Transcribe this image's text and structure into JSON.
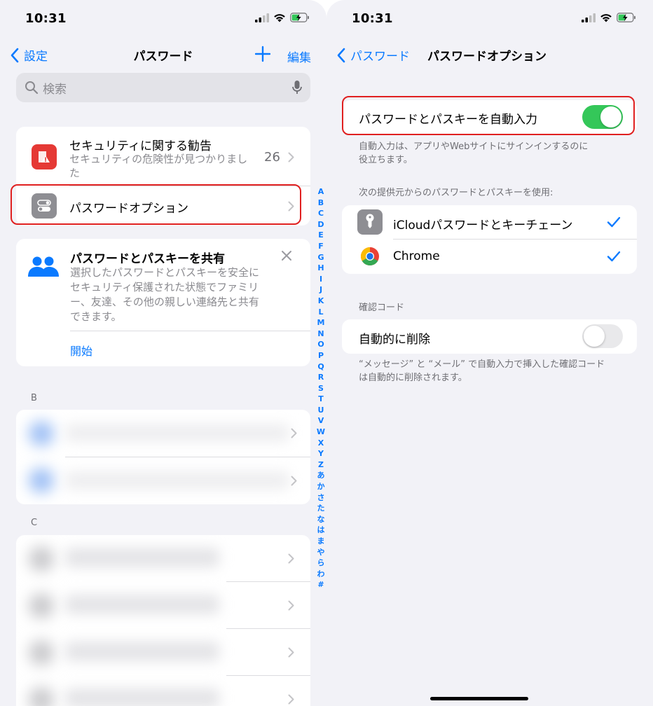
{
  "left": {
    "status_time": "10:31",
    "nav": {
      "back_label": "設定",
      "title": "パスワード",
      "edit_label": "編集"
    },
    "search": {
      "placeholder": "検索"
    },
    "security": {
      "title": "セキュリティに関する勧告",
      "subtitle_line1": "セキュリティの危険性が見つかりまし",
      "subtitle_line2": "た",
      "count": "26"
    },
    "options_row": {
      "label": "パスワードオプション"
    },
    "share_card": {
      "title": "パスワードとパスキーを共有",
      "body_line1": "選択したパスワードとパスキーを安全に",
      "body_line2": "セキュリティ保護された状態でファミリ",
      "body_line3": "ー、友達、その他の親しい連絡先と共有",
      "body_line4": "できます。",
      "start_label": "開始"
    },
    "section_b": "B",
    "section_c": "C",
    "index_letters": [
      "A",
      "B",
      "C",
      "D",
      "E",
      "F",
      "G",
      "H",
      "I",
      "J",
      "K",
      "L",
      "M",
      "N",
      "O",
      "P",
      "Q",
      "R",
      "S",
      "T",
      "U",
      "V",
      "W",
      "X",
      "Y",
      "Z",
      "あ",
      "か",
      "さ",
      "た",
      "な",
      "は",
      "ま",
      "や",
      "ら",
      "わ",
      "#"
    ]
  },
  "right": {
    "status_time": "10:31",
    "nav": {
      "back_label": "パスワード",
      "title": "パスワードオプション"
    },
    "autofill": {
      "label": "パスワードとパスキーを自動入力",
      "enabled": true,
      "footer_line1": "自動入力は、アプリやWebサイトにサインインするのに",
      "footer_line2": "役立ちます。"
    },
    "providers_header": "次の提供元からのパスワードとパスキーを使用:",
    "providers": [
      {
        "label": "iCloudパスワードとキーチェーン",
        "checked": true
      },
      {
        "label": "Chrome",
        "checked": true
      }
    ],
    "codes_header": "確認コード",
    "auto_delete": {
      "label": "自動的に削除",
      "enabled": false,
      "footer_line1": "“メッセージ” と “メール” で自動入力で挿入した確認コード",
      "footer_line2": "は自動的に削除されます。"
    }
  },
  "colors": {
    "accent": "#0a7aff",
    "toggle_on": "#34c759",
    "toggle_off": "#e9e9eb",
    "highlight": "#e02020",
    "security_red": "#e53935"
  }
}
